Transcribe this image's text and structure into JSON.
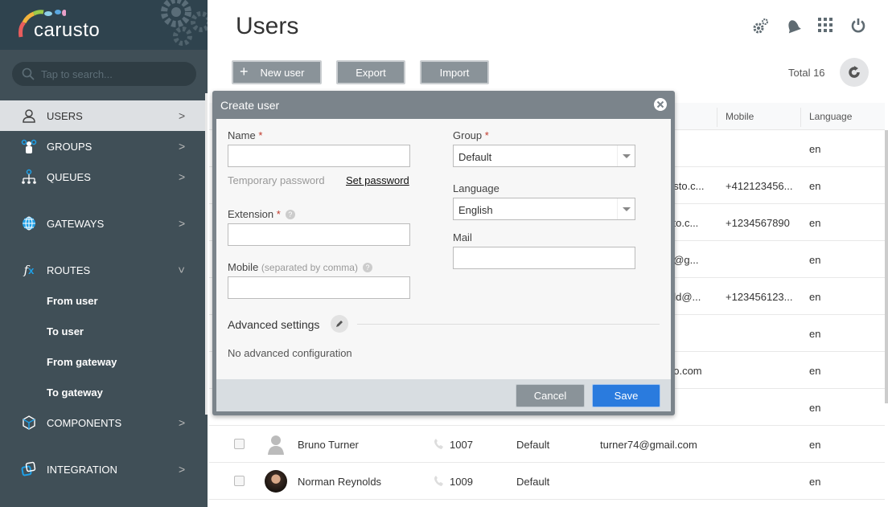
{
  "brand": {
    "name": "carusto"
  },
  "search": {
    "placeholder": "Tap to search..."
  },
  "sidebar": {
    "items": [
      {
        "label": "USERS",
        "icon": "user-icon",
        "active": true
      },
      {
        "label": "GROUPS",
        "icon": "group-icon"
      },
      {
        "label": "QUEUES",
        "icon": "queue-icon"
      },
      {
        "label": "GATEWAYS",
        "icon": "globe-icon"
      },
      {
        "label": "ROUTES",
        "icon": "function-icon",
        "expanded": true
      },
      {
        "label": "COMPONENTS",
        "icon": "cube-icon"
      },
      {
        "label": "INTEGRATION",
        "icon": "integration-icon"
      }
    ],
    "routes_sub": [
      "From user",
      "To user",
      "From gateway",
      "To gateway"
    ]
  },
  "header": {
    "title": "Users",
    "icons": [
      "settings-icon",
      "bell-icon",
      "apps-grid-icon",
      "power-icon"
    ]
  },
  "toolbar": {
    "new_user": "New user",
    "export": "Export",
    "import": "Import",
    "total": "Total 16"
  },
  "table": {
    "columns": [
      "Mobile",
      "Language"
    ],
    "rows": [
      {
        "mail": "",
        "mobile": "",
        "lang": "en"
      },
      {
        "mail": "usto.c...",
        "mobile": "+412123456...",
        "lang": "en"
      },
      {
        "mail": "sto.c...",
        "mobile": "+1234567890",
        "lang": "en"
      },
      {
        "mail": "n@g...",
        "mobile": "",
        "lang": "en"
      },
      {
        "mail": "ald@...",
        "mobile": "+123456123...",
        "lang": "en"
      },
      {
        "mail": "",
        "mobile": "",
        "lang": "en"
      },
      {
        "mail": "oo.com",
        "mobile": "",
        "lang": "en"
      },
      {
        "mail": "",
        "mobile": "",
        "lang": "en"
      },
      {
        "name": "Bruno Turner",
        "ext": "1007",
        "group": "Default",
        "mail": "turner74@gmail.com",
        "mobile": "",
        "lang": "en"
      },
      {
        "name": "Norman Reynolds",
        "ext": "1009",
        "group": "Default",
        "mail": "",
        "mobile": "",
        "lang": "en"
      }
    ]
  },
  "modal": {
    "title": "Create user",
    "name_label": "Name",
    "temp_password": "Temporary password",
    "set_password": "Set password",
    "extension_label": "Extension",
    "mobile_label": "Mobile",
    "mobile_hint": "(separated by comma)",
    "group_label": "Group",
    "group_value": "Default",
    "language_label": "Language",
    "language_value": "English",
    "mail_label": "Mail",
    "advanced_label": "Advanced settings",
    "advanced_empty": "No advanced configuration",
    "cancel": "Cancel",
    "save": "Save",
    "required_mark": "*",
    "help": "?"
  },
  "colors": {
    "sidebar": "#404f57",
    "accent": "#2a7bde",
    "modal_header": "#7b848b"
  }
}
